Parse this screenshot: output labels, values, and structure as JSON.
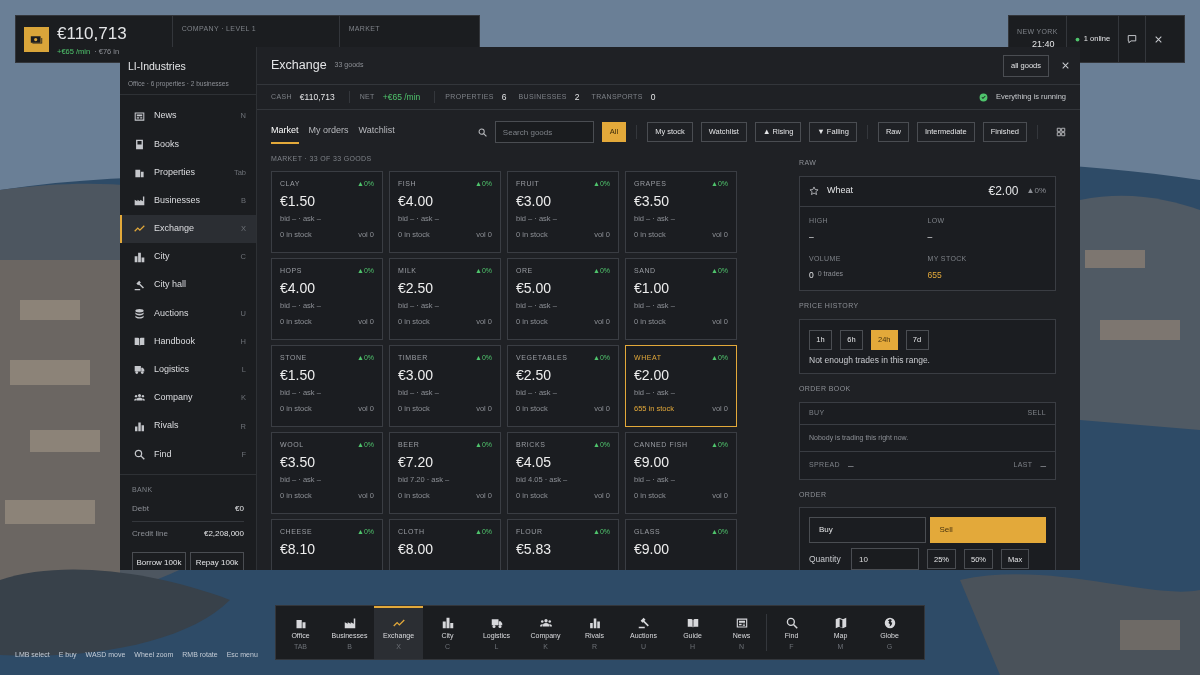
{
  "hud": {
    "cash": "€110,713",
    "rate": "+€65 /min",
    "rate_extra": "· €76 in",
    "columns": [
      "COMPANY · LEVEL 1",
      "MARKET"
    ]
  },
  "clock": {
    "city": "NEW YORK",
    "time": "21:40",
    "online": "1 online"
  },
  "sidebar": {
    "title": "LI-Industries",
    "subtitle": "Office · 6 properties · 2 businesses",
    "items": [
      {
        "label": "News",
        "key": "N",
        "selected": false
      },
      {
        "label": "Books",
        "selected": false
      },
      {
        "label": "Properties",
        "key": "Tab",
        "selected": false
      },
      {
        "label": "Businesses",
        "key": "B",
        "selected": false
      },
      {
        "label": "Exchange",
        "key": "X",
        "selected": true
      },
      {
        "label": "City",
        "key": "C",
        "selected": false
      },
      {
        "label": "City hall",
        "selected": false
      },
      {
        "label": "Auctions",
        "key": "U",
        "selected": false
      },
      {
        "label": "Handbook",
        "key": "H",
        "selected": false
      },
      {
        "label": "Logistics",
        "key": "L",
        "selected": false
      },
      {
        "label": "Company",
        "key": "K",
        "selected": false
      },
      {
        "label": "Rivals",
        "key": "R",
        "selected": false
      },
      {
        "label": "Find",
        "key": "F",
        "selected": false
      }
    ],
    "bank": {
      "title": "BANK",
      "rows": [
        {
          "label": "Debt",
          "value": "€0"
        },
        {
          "label": "Credit line",
          "value": "€2,208,000"
        }
      ],
      "buttons": [
        "Borrow 100k",
        "Repay 100k"
      ]
    }
  },
  "exchange": {
    "title": "Exchange",
    "count": "33 goods",
    "scope_button": "all goods",
    "stats": [
      {
        "label": "CASH",
        "value": "€110,713",
        "kind": "plain"
      },
      {
        "label": "NET",
        "value": "+€65 /min",
        "kind": "positive"
      },
      {
        "label": "PROPERTIES",
        "value": "6",
        "kind": "plain"
      },
      {
        "label": "BUSINESSES",
        "value": "2",
        "kind": "plain"
      },
      {
        "label": "TRANSPORTS",
        "value": "0",
        "kind": "plain"
      }
    ],
    "status": "Everything is running",
    "tabs": [
      {
        "label": "Market",
        "selected": true
      },
      {
        "label": "My orders",
        "selected": false
      },
      {
        "label": "Watchlist",
        "selected": false
      }
    ],
    "search_placeholder": "Search goods",
    "filters": [
      {
        "label": "All",
        "selected": true,
        "separator_before": false
      },
      {
        "label": "My stock",
        "selected": false,
        "separator_before": true
      },
      {
        "label": "Watchlist",
        "selected": false,
        "separator_before": false
      },
      {
        "label": "▲ Rising",
        "selected": false,
        "separator_before": false
      },
      {
        "label": "▼ Falling",
        "selected": false,
        "separator_before": false
      },
      {
        "label": "Raw",
        "selected": false,
        "separator_before": true
      },
      {
        "label": "Intermediate",
        "selected": false,
        "separator_before": false
      },
      {
        "label": "Finished",
        "selected": false,
        "separator_before": false
      }
    ],
    "section_label": "MARKET · 33 OF 33 GOODS",
    "goods": [
      {
        "name": "CLAY",
        "change": "▲0%",
        "price": "€1.50",
        "quote": "bid – · ask –",
        "stock": "0 in stock",
        "volume": "vol 0",
        "selected": false
      },
      {
        "name": "FISH",
        "change": "▲0%",
        "price": "€4.00",
        "quote": "bid – · ask –",
        "stock": "0 in stock",
        "volume": "vol 0",
        "selected": false
      },
      {
        "name": "FRUIT",
        "change": "▲0%",
        "price": "€3.00",
        "quote": "bid – · ask –",
        "stock": "0 in stock",
        "volume": "vol 0",
        "selected": false
      },
      {
        "name": "GRAPES",
        "change": "▲0%",
        "price": "€3.50",
        "quote": "bid – · ask –",
        "stock": "0 in stock",
        "volume": "vol 0",
        "selected": false
      },
      {
        "name": "HOPS",
        "change": "▲0%",
        "price": "€4.00",
        "quote": "bid – · ask –",
        "stock": "0 in stock",
        "volume": "vol 0",
        "selected": false
      },
      {
        "name": "MILK",
        "change": "▲0%",
        "price": "€2.50",
        "quote": "bid – · ask –",
        "stock": "0 in stock",
        "volume": "vol 0",
        "selected": false
      },
      {
        "name": "ORE",
        "change": "▲0%",
        "price": "€5.00",
        "quote": "bid – · ask –",
        "stock": "0 in stock",
        "volume": "vol 0",
        "selected": false
      },
      {
        "name": "SAND",
        "change": "▲0%",
        "price": "€1.00",
        "quote": "bid – · ask –",
        "stock": "0 in stock",
        "volume": "vol 0",
        "selected": false
      },
      {
        "name": "STONE",
        "change": "▲0%",
        "price": "€1.50",
        "quote": "bid – · ask –",
        "stock": "0 in stock",
        "volume": "vol 0",
        "selected": false
      },
      {
        "name": "TIMBER",
        "change": "▲0%",
        "price": "€3.00",
        "quote": "bid – · ask –",
        "stock": "0 in stock",
        "volume": "vol 0",
        "selected": false
      },
      {
        "name": "VEGETABLES",
        "change": "▲0%",
        "price": "€2.50",
        "quote": "bid – · ask –",
        "stock": "0 in stock",
        "volume": "vol 0",
        "selected": false
      },
      {
        "name": "WHEAT",
        "change": "▲0%",
        "price": "€2.00",
        "quote": "bid – · ask –",
        "stock": "655 in stock",
        "volume": "vol 0",
        "selected": true
      },
      {
        "name": "WOOL",
        "change": "▲0%",
        "price": "€3.50",
        "quote": "bid – · ask –",
        "stock": "0 in stock",
        "volume": "vol 0",
        "selected": false
      },
      {
        "name": "BEER",
        "change": "▲0%",
        "price": "€7.20",
        "quote": "bid 7.20 · ask –",
        "stock": "0 in stock",
        "volume": "vol 0",
        "selected": false
      },
      {
        "name": "BRICKS",
        "change": "▲0%",
        "price": "€4.05",
        "quote": "bid 4.05 · ask –",
        "stock": "0 in stock",
        "volume": "vol 0",
        "selected": false
      },
      {
        "name": "CANNED FISH",
        "change": "▲0%",
        "price": "€9.00",
        "quote": "bid – · ask –",
        "stock": "0 in stock",
        "volume": "vol 0",
        "selected": false
      },
      {
        "name": "CHEESE",
        "change": "▲0%",
        "price": "€8.10",
        "selected": false
      },
      {
        "name": "CLOTH",
        "change": "▲0%",
        "price": "€8.00",
        "selected": false
      },
      {
        "name": "FLOUR",
        "change": "▲0%",
        "price": "€5.83",
        "selected": false
      },
      {
        "name": "GLASS",
        "change": "▲0%",
        "price": "€9.00",
        "selected": false
      }
    ]
  },
  "detail": {
    "category": "RAW",
    "name": "Wheat",
    "starred": false,
    "price": "€2.00",
    "change": "▲0%",
    "stats": [
      {
        "label": "HIGH",
        "value": "–",
        "kind": "plain"
      },
      {
        "label": "LOW",
        "value": "–",
        "kind": "plain"
      },
      {
        "label": "VOLUME",
        "value": "0",
        "note": "0 trades",
        "kind": "plain"
      },
      {
        "label": "MY STOCK",
        "value": "655",
        "kind": "highlight"
      }
    ],
    "history_label": "PRICE HISTORY",
    "ranges": [
      {
        "label": "1h",
        "selected": false
      },
      {
        "label": "6h",
        "selected": false
      },
      {
        "label": "24h",
        "selected": true
      },
      {
        "label": "7d",
        "selected": false
      }
    ],
    "history_note": "Not enough trades in this range.",
    "book_label": "ORDER BOOK",
    "book_buy": "BUY",
    "book_sell": "SELL",
    "book_empty": "Nobody is trading this right now.",
    "spread_label": "SPREAD",
    "spread_value": "–",
    "last_label": "LAST",
    "last_value": "–",
    "order_label": "ORDER",
    "sides": [
      {
        "label": "Buy",
        "selected": false
      },
      {
        "label": "Sell",
        "selected": true
      }
    ],
    "quantity_label": "Quantity",
    "quantity_value": "10",
    "presets": [
      "25%",
      "50%",
      "Max"
    ]
  },
  "dock": [
    {
      "label": "Office",
      "key": "TAB",
      "selected": false,
      "separator_before": false
    },
    {
      "label": "Businesses",
      "key": "B",
      "selected": false,
      "separator_before": false
    },
    {
      "label": "Exchange",
      "key": "X",
      "selected": true,
      "separator_before": false
    },
    {
      "label": "City",
      "key": "C",
      "selected": false,
      "separator_before": false
    },
    {
      "label": "Logistics",
      "key": "L",
      "selected": false,
      "separator_before": false
    },
    {
      "label": "Company",
      "key": "K",
      "selected": false,
      "separator_before": false
    },
    {
      "label": "Rivals",
      "key": "R",
      "selected": false,
      "separator_before": false
    },
    {
      "label": "Auctions",
      "key": "U",
      "selected": false,
      "separator_before": false
    },
    {
      "label": "Guide",
      "key": "H",
      "selected": false,
      "separator_before": false
    },
    {
      "label": "News",
      "key": "N",
      "selected": false,
      "separator_before": false
    },
    {
      "label": "Find",
      "key": "F",
      "selected": false,
      "separator_before": true
    },
    {
      "label": "Map",
      "key": "M",
      "selected": false,
      "separator_before": false
    },
    {
      "label": "Globe",
      "key": "G",
      "selected": false,
      "separator_before": false
    }
  ],
  "hints": [
    {
      "key": "LMB",
      "action": "select"
    },
    {
      "key": "E",
      "action": "buy"
    },
    {
      "key": "WASD",
      "action": "move"
    },
    {
      "key": "Wheel",
      "action": "zoom"
    },
    {
      "key": "RMB",
      "action": "rotate"
    },
    {
      "key": "Esc",
      "action": "menu"
    }
  ]
}
